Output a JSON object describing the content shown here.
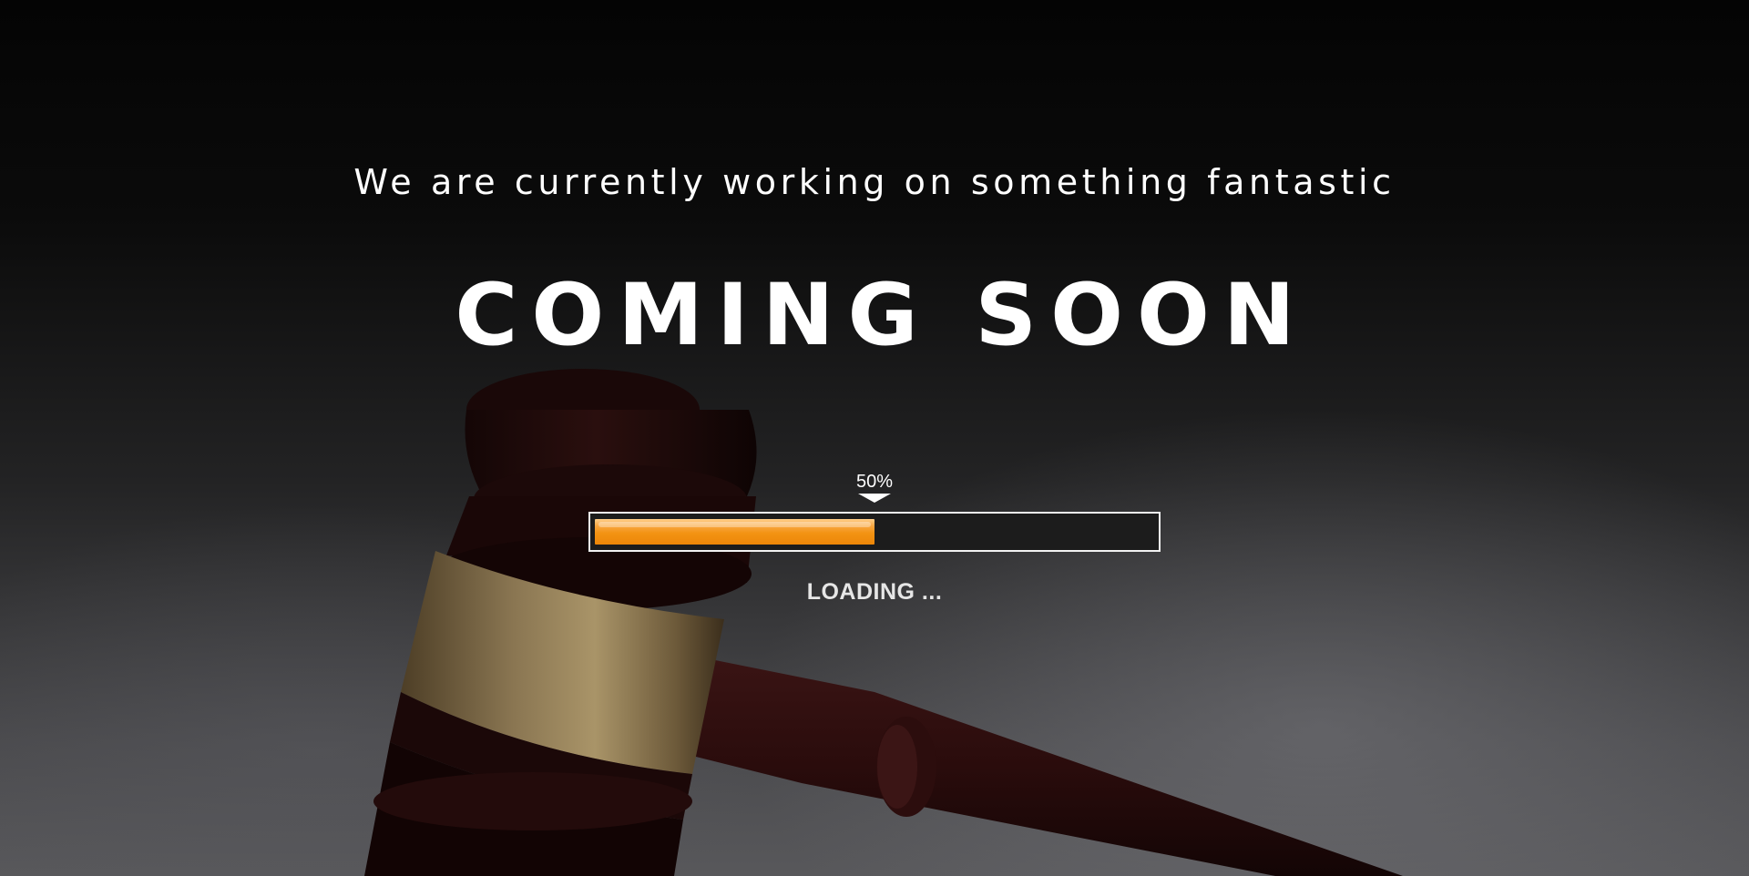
{
  "hero": {
    "tagline": "We are currently working on something fantastic",
    "headline": "COMING SOON"
  },
  "progress": {
    "value_percent": 50,
    "label": "50%",
    "status_text": "LOADING ...",
    "fill_color": "#F39313",
    "track_color": "#1C1C1C",
    "border_color": "#F2F2F2"
  },
  "background": {
    "image_subject": "gavel-icon"
  }
}
